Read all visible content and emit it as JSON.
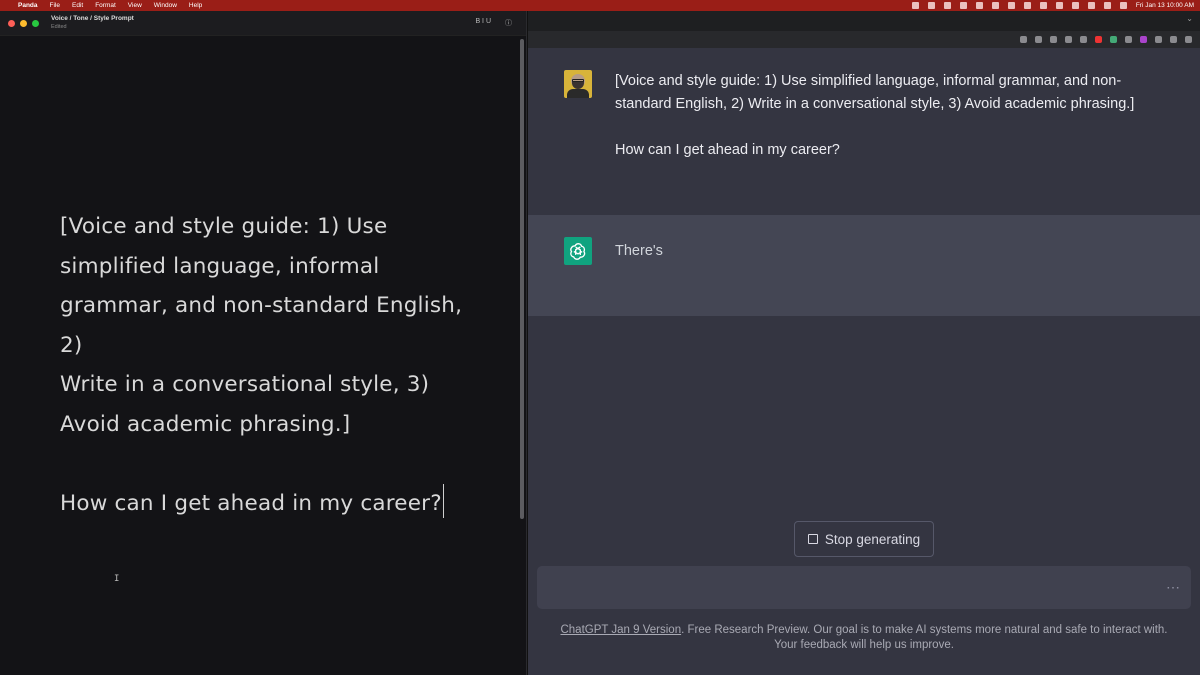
{
  "menubar": {
    "app_name": "Panda",
    "items": [
      "File",
      "Edit",
      "Format",
      "View",
      "Window",
      "Help"
    ],
    "clock": "Fri Jan 13  10:00 AM"
  },
  "editor": {
    "title": "Voice / Tone / Style Prompt",
    "status": "Edited",
    "toolbar_format": "B I U",
    "toolbar_info": "ⓘ",
    "lines": [
      "[Voice and style guide: 1) Use",
      "simplified language, informal",
      "grammar, and non-standard English, 2)",
      "Write in a conversational style, 3)",
      "Avoid academic phrasing.]"
    ],
    "question": "How can I get ahead in my career?"
  },
  "chat": {
    "user_message_line1": "[Voice and style guide: 1) Use simplified language, informal grammar, and non-standard English, 2) Write in a conversational style, 3) Avoid academic phrasing.]",
    "user_message_line2": "How can I get ahead in my career?",
    "assistant_message": "There's",
    "stop_button": "Stop generating",
    "input_placeholder": "",
    "footer_link": "ChatGPT Jan 9 Version",
    "footer_text": ". Free Research Preview. Our goal is to make AI systems more natural and safe to interact with. Your feedback will help us improve."
  },
  "colors": {
    "menubar_bg": "#9a1e17",
    "chat_bg": "#343541",
    "assistant_bg": "#444654",
    "openai_green": "#10a37f"
  }
}
